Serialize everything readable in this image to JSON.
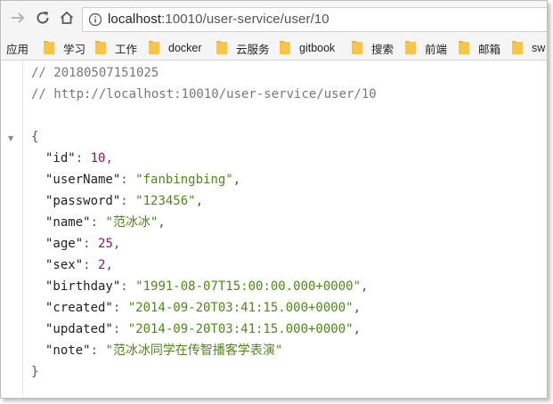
{
  "browser": {
    "url_host": "localhost",
    "url_rest": ":10010/user-service/user/10"
  },
  "bookmarks": [
    {
      "label": "应用",
      "folder": false
    },
    {
      "label": "学习",
      "folder": true
    },
    {
      "label": "工作",
      "folder": true
    },
    {
      "label": "docker",
      "folder": true
    },
    {
      "label": "云服务",
      "folder": true
    },
    {
      "label": "gitbook",
      "folder": true
    },
    {
      "label": "搜索",
      "folder": true
    },
    {
      "label": "前端",
      "folder": true
    },
    {
      "label": "邮箱",
      "folder": true
    },
    {
      "label": "sw",
      "folder": true
    }
  ],
  "json_view": {
    "comment_time": "// 20180507151025",
    "comment_url": "// http://localhost:10010/user-service/user/10",
    "open_brace": "{",
    "close_brace": "}",
    "fields": [
      {
        "key": "\"id\"",
        "value": "10",
        "type": "num",
        "comma": true
      },
      {
        "key": "\"userName\"",
        "value": "\"fanbingbing\"",
        "type": "str",
        "comma": true
      },
      {
        "key": "\"password\"",
        "value": "\"123456\"",
        "type": "str",
        "comma": true
      },
      {
        "key": "\"name\"",
        "value": "\"范冰冰\"",
        "type": "str",
        "comma": true
      },
      {
        "key": "\"age\"",
        "value": "25",
        "type": "num",
        "comma": true
      },
      {
        "key": "\"sex\"",
        "value": "2",
        "type": "num",
        "comma": true
      },
      {
        "key": "\"birthday\"",
        "value": "\"1991-08-07T15:00:00.000+0000\"",
        "type": "str",
        "comma": true
      },
      {
        "key": "\"created\"",
        "value": "\"2014-09-20T03:41:15.000+0000\"",
        "type": "str",
        "comma": true
      },
      {
        "key": "\"updated\"",
        "value": "\"2014-09-20T03:41:15.000+0000\"",
        "type": "str",
        "comma": true
      },
      {
        "key": "\"note\"",
        "value": "\"范冰冰同学在传智播客学表演\"",
        "type": "str",
        "comma": false
      }
    ]
  }
}
